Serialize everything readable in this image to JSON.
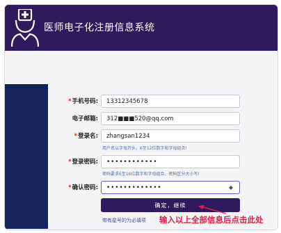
{
  "app": {
    "title": "医师电子化注册信息系统"
  },
  "form": {
    "required_mark": "*",
    "phone": {
      "label": "手机号码:",
      "value": "13312345678"
    },
    "email": {
      "label": "电子邮箱:",
      "value": "312■■■520@qq.com"
    },
    "username": {
      "label": "登录名:",
      "value": "zhangsan1234",
      "hint": "用户名以字母开头，6至12位数字和字母组合!"
    },
    "password": {
      "label": "登录密码:",
      "value": "••••••••••••",
      "hint": "密码要求6至16位数字和字母组合，密码区分大小写!"
    },
    "confirm": {
      "label": "确认密码:",
      "value": "•••••••••••••"
    },
    "submit_label": "确定，继续",
    "required_note": "带有星号的为必填项"
  },
  "annotation": {
    "text": "输入以上全部信息后点击此处",
    "color": "#e0204a"
  },
  "colors": {
    "header": "#2e1a5c",
    "side_panel": "#16225a",
    "button": "#2e1a5c"
  },
  "icons": {
    "logo": "doctor-avatar-icon",
    "password_toggle": "eye-icon"
  }
}
